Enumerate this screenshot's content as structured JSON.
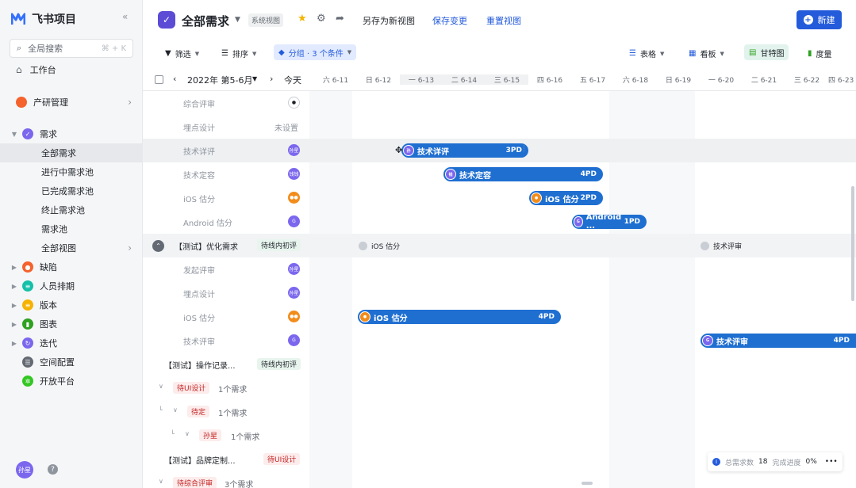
{
  "app": {
    "name": "飞书项目",
    "collapse": "«"
  },
  "search": {
    "placeholder": "全局搜索",
    "shortcut": "⌘ + K"
  },
  "nav": {
    "workbench": "工作台",
    "product": "产研管理",
    "requirements": "需求",
    "sub_items": [
      "全部需求",
      "进行中需求池",
      "已完成需求池",
      "终止需求池",
      "需求池",
      "全部视图"
    ],
    "others": [
      "缺陷",
      "人员排期",
      "版本",
      "图表",
      "迭代",
      "空间配置",
      "开放平台"
    ],
    "other_colors": [
      "#f5622d",
      "#14c0aa",
      "#f5b300",
      "#2ea121",
      "#7b67ee",
      "#646a73",
      "#34c724"
    ]
  },
  "user": {
    "name": "孙星"
  },
  "header": {
    "title": "全部需求",
    "system_view": "系统视图",
    "save_as": "另存为新视图",
    "save_changes": "保存变更",
    "reset_view": "重置视图",
    "new": "新建"
  },
  "toolbar": {
    "filter": "筛选",
    "sort": "排序",
    "group": "分组 · 3 个条件",
    "table": "表格",
    "kanban": "看板",
    "gantt": "甘特图",
    "measure": "度量"
  },
  "datebar": {
    "range": "2022年 第5-6月",
    "today": "今天",
    "days": [
      "六 6-11",
      "日 6-12",
      "一 6-13",
      "二 6-14",
      "三 6-15",
      "四 6-16",
      "五 6-17",
      "六 6-18",
      "日 6-19",
      "一 6-20",
      "二 6-21",
      "三 6-22",
      "四 6-23"
    ]
  },
  "rows": {
    "r1": "综合评审",
    "r2": "埋点设计",
    "r2_value": "未设置",
    "r3": "技术详评",
    "r4": "技术定容",
    "r5": "iOS 估分",
    "r6": "Android 估分",
    "g1_title": "【测试】优化需求",
    "g1_tag": "待线内初评",
    "g1_ms1": "iOS 估分",
    "g1_ms2": "技术评审",
    "r7": "发起评审",
    "r8": "埋点设计",
    "r9": "iOS 估分",
    "r10": "技术评审",
    "g2_title": "【测试】操作记录...",
    "g2_tag": "待线内初评",
    "s1_tag": "待UI设计",
    "s1_count": "1个需求",
    "s2_tag": "待定",
    "s2_count": "1个需求",
    "s3_tag": "孙星",
    "s3_count": "1个需求",
    "g3_title": "【测试】品牌定制...",
    "g3_tag": "待UI设计",
    "s4_tag": "待综合评审",
    "s4_count": "3个需求"
  },
  "bars": {
    "b1": {
      "label": "技术详评",
      "pd": "3PD"
    },
    "b2": {
      "label": "技术定容",
      "pd": "4PD"
    },
    "b3": {
      "label": "iOS 估分",
      "pd": "2PD"
    },
    "b4": {
      "label": "Android ...",
      "pd": "1PD"
    },
    "b5": {
      "label": "iOS 估分",
      "pd": "4PD"
    },
    "b6": {
      "label": "技术评审",
      "pd": "4PD"
    }
  },
  "footer": {
    "total_label": "总需求数",
    "total": "18",
    "progress_label": "完成进度",
    "progress": "0%",
    "more": "•••"
  },
  "colors": {
    "accent": "#245bdb",
    "bar": "#1f6fd1",
    "orange": "#f28c1a",
    "purple": "#7b67ee"
  }
}
